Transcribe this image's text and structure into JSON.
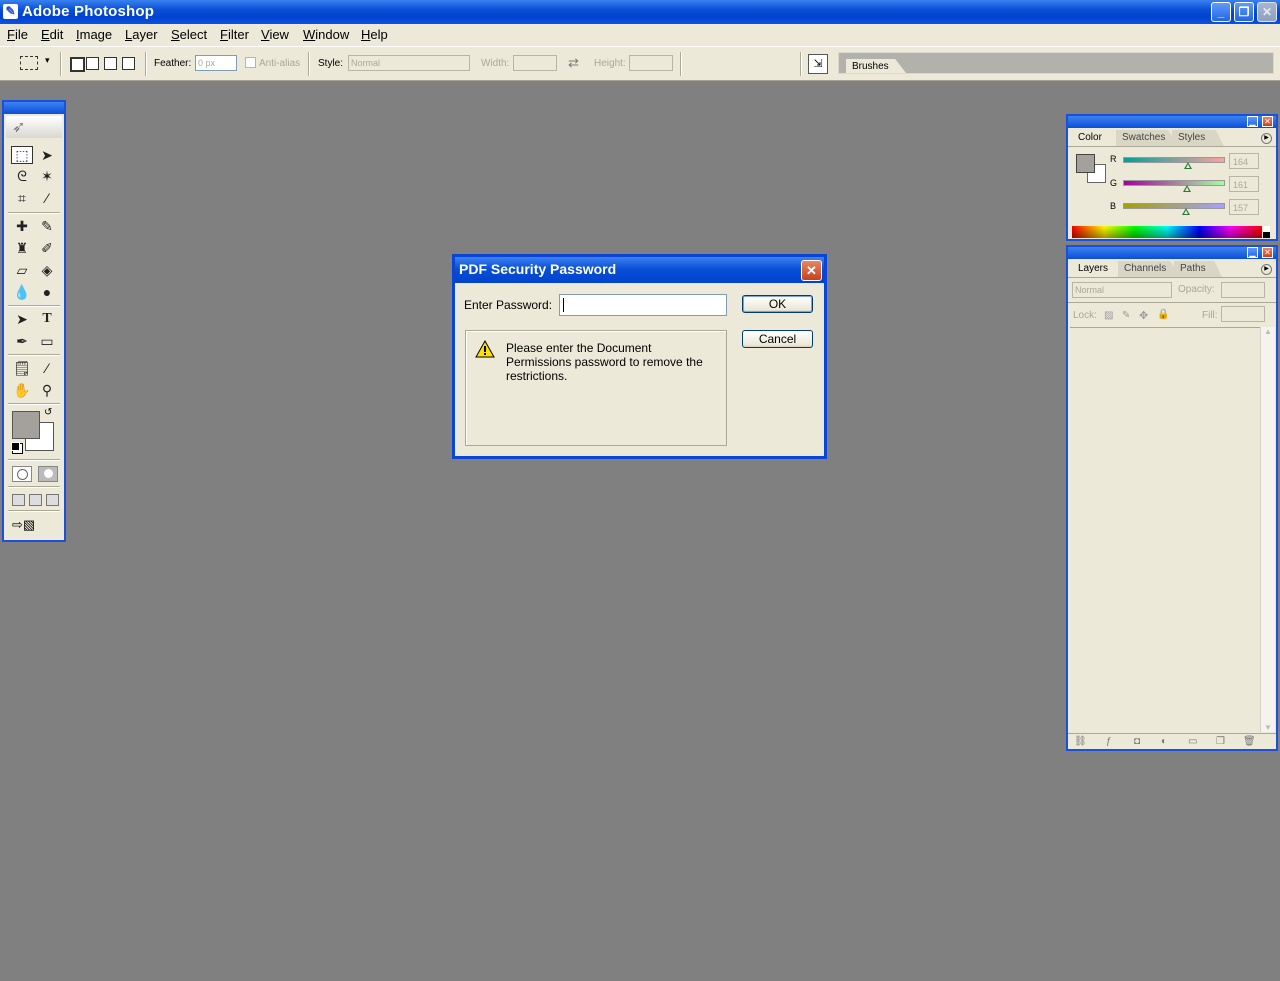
{
  "window": {
    "title": "Adobe Photoshop"
  },
  "menu": [
    "File",
    "Edit",
    "Image",
    "Layer",
    "Select",
    "Filter",
    "View",
    "Window",
    "Help"
  ],
  "options": {
    "feather_label": "Feather:",
    "feather_value": "0 px",
    "antialias_label": "Anti-alias",
    "style_label": "Style:",
    "style_value": "Normal",
    "width_label": "Width:",
    "height_label": "Height:",
    "brushes_tab": "Brushes"
  },
  "color_palette": {
    "tabs": [
      "Color",
      "Swatches",
      "Styles"
    ],
    "channels": [
      {
        "label": "R",
        "value": "164",
        "level": 0.64
      },
      {
        "label": "G",
        "value": "161",
        "level": 0.63
      },
      {
        "label": "B",
        "value": "157",
        "level": 0.62
      }
    ],
    "foreground": "#a4a19d"
  },
  "layers_palette": {
    "tabs": [
      "Layers",
      "Channels",
      "Paths"
    ],
    "blend_mode": "Normal",
    "opacity_label": "Opacity:",
    "lock_label": "Lock:",
    "fill_label": "Fill:"
  },
  "dialog": {
    "title": "PDF Security Password",
    "password_label": "Enter Password:",
    "password_value": "",
    "ok_label": "OK",
    "cancel_label": "Cancel",
    "message": "Please enter the Document Permissions password to remove the restrictions."
  }
}
